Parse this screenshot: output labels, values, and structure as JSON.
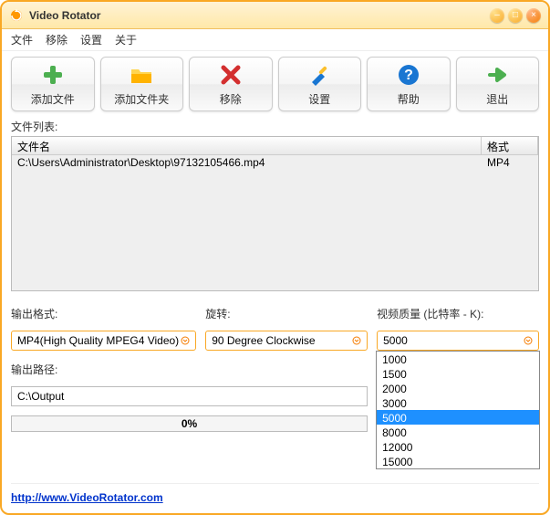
{
  "titlebar": {
    "title": "Video Rotator"
  },
  "menu": {
    "file": "文件",
    "remove": "移除",
    "settings": "设置",
    "about": "关于"
  },
  "toolbar": {
    "add_file": "添加文件",
    "add_folder": "添加文件夹",
    "remove": "移除",
    "settings": "设置",
    "help": "帮助",
    "exit": "退出"
  },
  "list": {
    "heading": "文件列表:",
    "col_name": "文件名",
    "col_format": "格式",
    "rows": [
      {
        "name": "C:\\Users\\Administrator\\Desktop\\97132105466.mp4",
        "format": "MP4"
      }
    ]
  },
  "output_format": {
    "label": "输出格式:",
    "value": "MP4(High Quality MPEG4 Video)"
  },
  "rotation": {
    "label": "旋转:",
    "value": "90 Degree Clockwise"
  },
  "quality": {
    "label": "视频质量 (比特率 - K):",
    "value": "5000",
    "options": [
      "1000",
      "1500",
      "2000",
      "3000",
      "5000",
      "8000",
      "12000",
      "15000"
    ],
    "selected": "5000"
  },
  "output_path": {
    "label": "输出路径:",
    "value": "C:\\Output"
  },
  "progress": {
    "percent_text": "0%",
    "percent_value": 0
  },
  "footer": {
    "link": "http://www.VideoRotator.com"
  }
}
